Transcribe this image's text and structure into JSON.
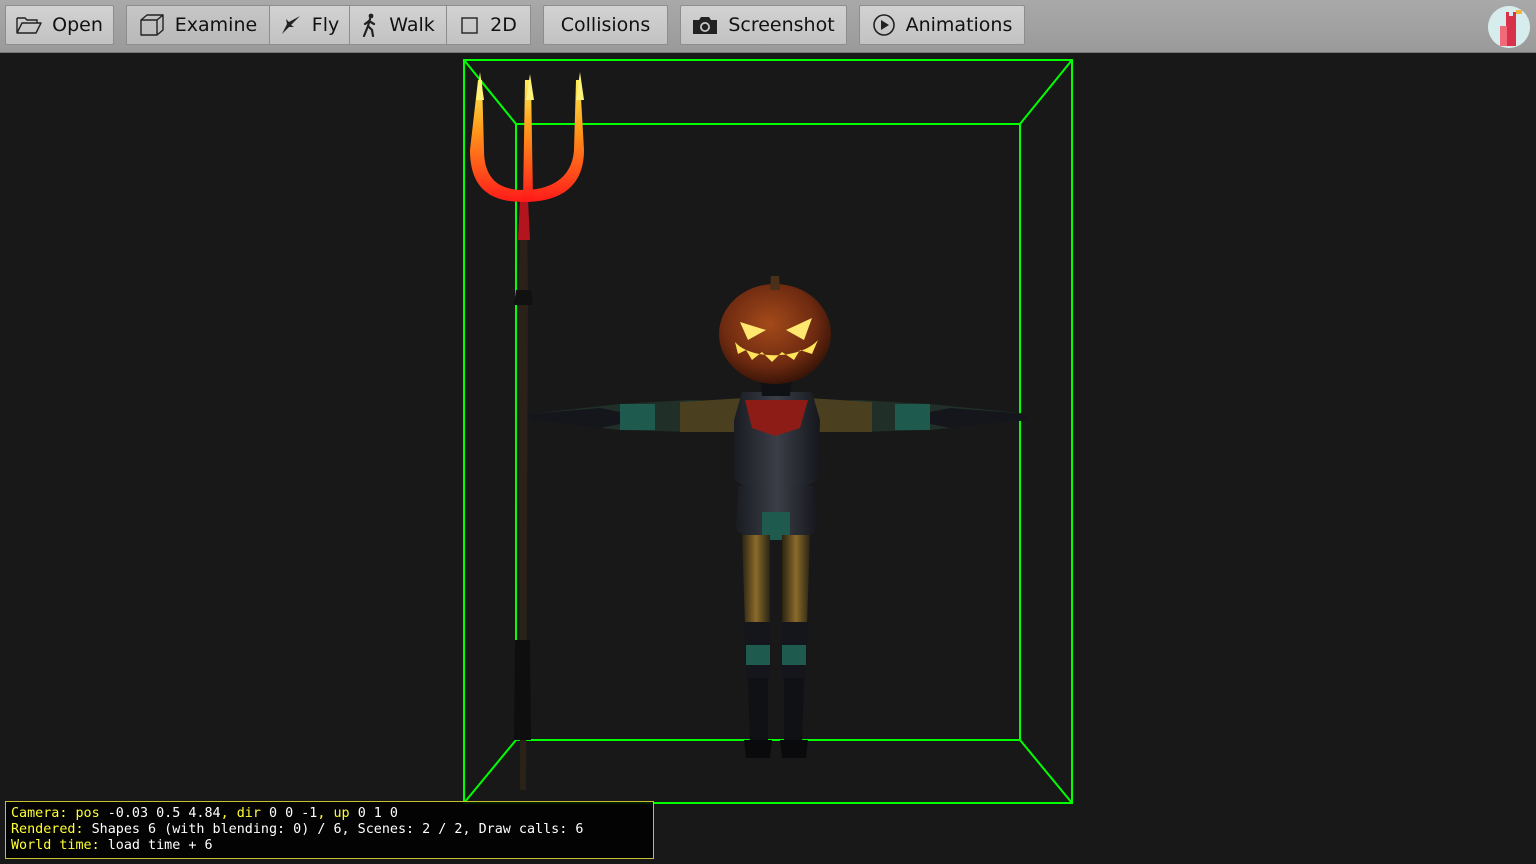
{
  "toolbar": {
    "open_label": "Open",
    "examine_label": "Examine",
    "fly_label": "Fly",
    "walk_label": "Walk",
    "two_d_label": "2D",
    "collisions_label": "Collisions",
    "screenshot_label": "Screenshot",
    "animations_label": "Animations",
    "active_mode": "Examine"
  },
  "icons": {
    "open": "folder-icon",
    "examine": "cube-icon",
    "fly": "plane-icon",
    "walk": "walking-person-icon",
    "two_d": "square-icon",
    "screenshot": "camera-icon",
    "animations": "play-circle-icon",
    "app": "castle-logo-icon"
  },
  "scene": {
    "bounding_box_color": "#00ff00",
    "background_color": "#181818",
    "object": "pumpkin-head scarecrow with trident"
  },
  "hud": {
    "line1": {
      "camera_key": "Camera:",
      "pos_key": "pos",
      "pos_val": "-0.03 0.5 4.84",
      "dir_key": ", dir",
      "dir_val": "0 0 -1",
      "up_key": ", up",
      "up_val": "0 1 0"
    },
    "line2": {
      "rendered_key": "Rendered:",
      "rendered_val": "Shapes 6 (with blending: 0) / 6, Scenes: 2 / 2, Draw calls: 6"
    },
    "line3": {
      "world_key": "World time:",
      "world_val": "load time + 6"
    },
    "label_color": "#ffff33",
    "value_color": "#ffffff"
  }
}
